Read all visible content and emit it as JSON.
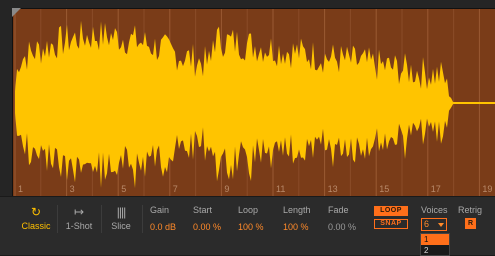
{
  "colors": {
    "waveform": "#ffc400",
    "background": "#7a3c18",
    "accent": "#ff6f1a"
  },
  "timeline": {
    "markers": [
      "1",
      "3",
      "5",
      "7",
      "9",
      "11",
      "13",
      "15",
      "17",
      "19"
    ]
  },
  "modes": [
    {
      "label": "Classic",
      "icon": "loop-arrow-icon",
      "active": true
    },
    {
      "label": "1-Shot",
      "icon": "one-shot-arrow-icon",
      "active": false
    },
    {
      "label": "Slice",
      "icon": "slice-bars-icon",
      "active": false
    }
  ],
  "params": {
    "gain": {
      "label": "Gain",
      "value": "0.0 dB"
    },
    "start": {
      "label": "Start",
      "value": "0.00 %"
    },
    "loop": {
      "label": "Loop",
      "value": "100 %"
    },
    "length": {
      "label": "Length",
      "value": "100 %"
    },
    "fade": {
      "label": "Fade",
      "value": "0.00 %"
    }
  },
  "buttons": {
    "loop": "LOOP",
    "snap": "SNAP"
  },
  "voices": {
    "label": "Voices",
    "value": "6",
    "options": [
      "1",
      "2"
    ]
  },
  "retrig": {
    "label": "Retrig",
    "button": "R"
  }
}
